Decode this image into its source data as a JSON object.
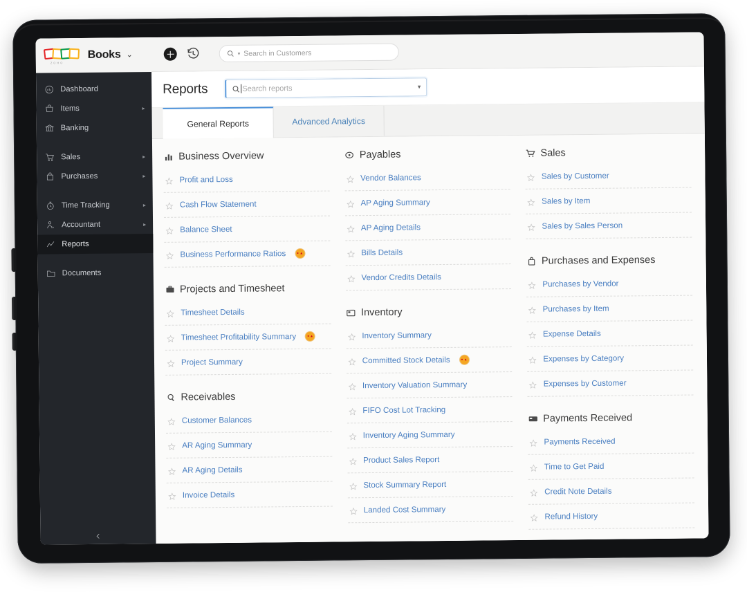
{
  "topbar": {
    "brand_name": "Books",
    "brand_caret": "⌄",
    "add_icon": "plus-icon",
    "history_icon": "clock-history-icon",
    "search_placeholder": "Search in Customers",
    "search_value": ""
  },
  "sidebar": {
    "items": [
      {
        "label": "Dashboard",
        "icon": "dashboard-icon",
        "arrow": "",
        "active": false
      },
      {
        "label": "Items",
        "icon": "items-basket-icon",
        "arrow": "▸",
        "active": false
      },
      {
        "label": "Banking",
        "icon": "bank-icon",
        "arrow": "",
        "active": false
      },
      {
        "label": "Sales",
        "icon": "cart-icon",
        "arrow": "▸",
        "active": false
      },
      {
        "label": "Purchases",
        "icon": "bag-icon",
        "arrow": "▸",
        "active": false
      },
      {
        "label": "Time Tracking",
        "icon": "stopwatch-icon",
        "arrow": "▸",
        "active": false
      },
      {
        "label": "Accountant",
        "icon": "accountant-icon",
        "arrow": "▸",
        "active": false
      },
      {
        "label": "Reports",
        "icon": "chart-line-icon",
        "arrow": "",
        "active": true
      },
      {
        "label": "Documents",
        "icon": "folder-icon",
        "arrow": "",
        "active": false
      }
    ],
    "collapse_icon": "chevron-left-icon"
  },
  "page": {
    "title": "Reports",
    "search_placeholder": "Search reports",
    "search_value": ""
  },
  "tabs": [
    {
      "label": "General Reports",
      "active": true
    },
    {
      "label": "Advanced Analytics",
      "active": false
    }
  ],
  "colors": {
    "link": "#4a7fc1",
    "accent": "#4a90d9",
    "badge": "#f5a623",
    "sidebar_bg": "#23262b"
  },
  "columns": [
    {
      "sections": [
        {
          "title": "Business Overview",
          "icon": "bar-chart-icon",
          "reports": [
            {
              "label": "Profit and Loss",
              "badge": false
            },
            {
              "label": "Cash Flow Statement",
              "badge": false
            },
            {
              "label": "Balance Sheet",
              "badge": false
            },
            {
              "label": "Business Performance Ratios",
              "badge": true
            }
          ]
        },
        {
          "title": "Projects and Timesheet",
          "icon": "briefcase-icon",
          "reports": [
            {
              "label": "Timesheet Details",
              "badge": false
            },
            {
              "label": "Timesheet Profitability Summary",
              "badge": true
            },
            {
              "label": "Project Summary",
              "badge": false
            }
          ]
        },
        {
          "title": "Receivables",
          "icon": "receivables-icon",
          "reports": [
            {
              "label": "Customer Balances",
              "badge": false
            },
            {
              "label": "AR Aging Summary",
              "badge": false
            },
            {
              "label": "AR Aging Details",
              "badge": false
            },
            {
              "label": "Invoice Details",
              "badge": false
            }
          ]
        }
      ]
    },
    {
      "sections": [
        {
          "title": "Payables",
          "icon": "payables-icon",
          "reports": [
            {
              "label": "Vendor Balances",
              "badge": false
            },
            {
              "label": "AP Aging Summary",
              "badge": false
            },
            {
              "label": "AP Aging Details",
              "badge": false
            },
            {
              "label": "Bills Details",
              "badge": false
            },
            {
              "label": "Vendor Credits Details",
              "badge": false
            }
          ]
        },
        {
          "title": "Inventory",
          "icon": "inventory-box-icon",
          "reports": [
            {
              "label": "Inventory Summary",
              "badge": false
            },
            {
              "label": "Committed Stock Details",
              "badge": true
            },
            {
              "label": "Inventory Valuation Summary",
              "badge": false
            },
            {
              "label": "FIFO Cost Lot Tracking",
              "badge": false
            },
            {
              "label": "Inventory Aging Summary",
              "badge": false
            },
            {
              "label": "Product Sales Report",
              "badge": false
            },
            {
              "label": "Stock Summary Report",
              "badge": false
            },
            {
              "label": "Landed Cost Summary",
              "badge": false
            }
          ]
        }
      ]
    },
    {
      "sections": [
        {
          "title": "Sales",
          "icon": "cart-icon",
          "reports": [
            {
              "label": "Sales by Customer",
              "badge": false
            },
            {
              "label": "Sales by Item",
              "badge": false
            },
            {
              "label": "Sales by Sales Person",
              "badge": false
            }
          ]
        },
        {
          "title": "Purchases and Expenses",
          "icon": "bag-icon",
          "reports": [
            {
              "label": "Purchases by Vendor",
              "badge": false
            },
            {
              "label": "Purchases by Item",
              "badge": false
            },
            {
              "label": "Expense Details",
              "badge": false
            },
            {
              "label": "Expenses by Category",
              "badge": false
            },
            {
              "label": "Expenses by Customer",
              "badge": false
            }
          ]
        },
        {
          "title": "Payments Received",
          "icon": "card-icon",
          "reports": [
            {
              "label": "Payments Received",
              "badge": false
            },
            {
              "label": "Time to Get Paid",
              "badge": false
            },
            {
              "label": "Credit Note Details",
              "badge": false
            },
            {
              "label": "Refund History",
              "badge": false
            }
          ]
        }
      ]
    }
  ]
}
